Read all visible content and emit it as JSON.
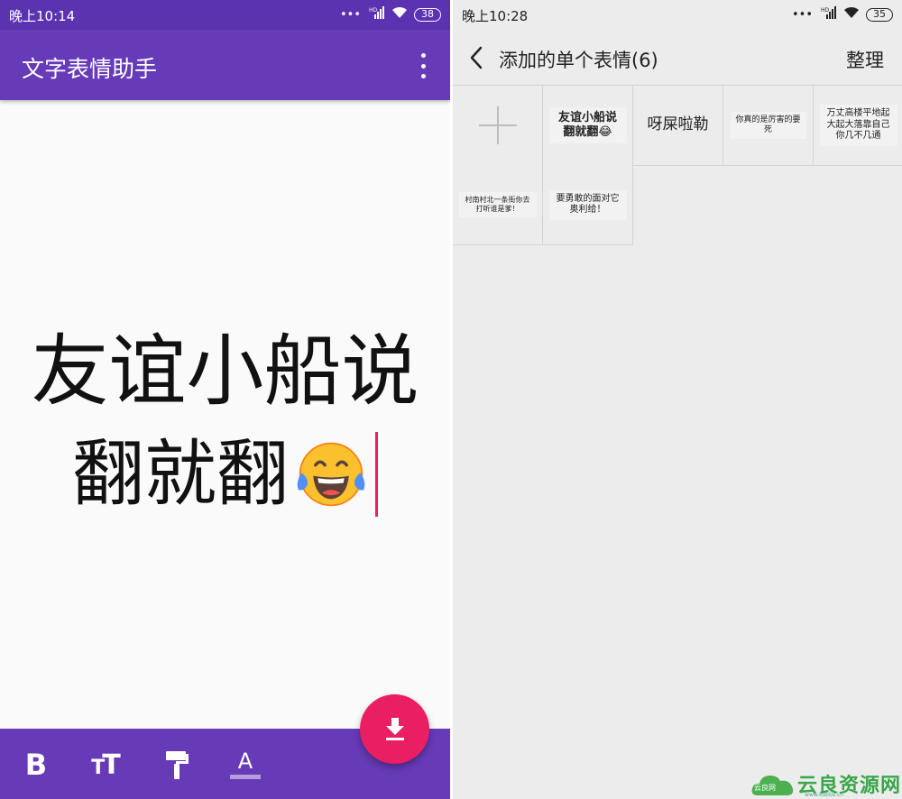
{
  "left_phone": {
    "status": {
      "time": "晚上10:14",
      "network": "HD",
      "battery": "38"
    },
    "app_title": "文字表情助手",
    "canvas": {
      "line1": "友谊小船说",
      "line2": "翻就翻",
      "emoji": "face-with-tears-of-joy"
    },
    "toolbar": {
      "bold_label": "B",
      "size_label_big": "T",
      "size_label_small": "T",
      "text_color_label": "A"
    },
    "fab_icon": "download-icon",
    "colors": {
      "primary": "#673ab7",
      "status_bar": "#5b33b0",
      "accent": "#e91e63"
    }
  },
  "right_phone": {
    "status": {
      "time": "晚上10:28",
      "network": "HD",
      "battery": "35"
    },
    "nav": {
      "title": "添加的单个表情(6)",
      "action": "整理"
    },
    "stickers": [
      {
        "text": "友谊小船说翻就翻😂"
      },
      {
        "text": "呀屎啦勒"
      },
      {
        "text": "你真的是厉害的要死"
      },
      {
        "text": "万丈高楼平地起大起大落靠自己你几不几通"
      },
      {
        "text": "村南村北一条街你去打听谁是爹！"
      },
      {
        "text": "要勇敢的面对它奥利给！"
      }
    ]
  },
  "watermark": {
    "text": "云良资源网",
    "sub": "www.kubbs.cn",
    "site": "云良网"
  }
}
